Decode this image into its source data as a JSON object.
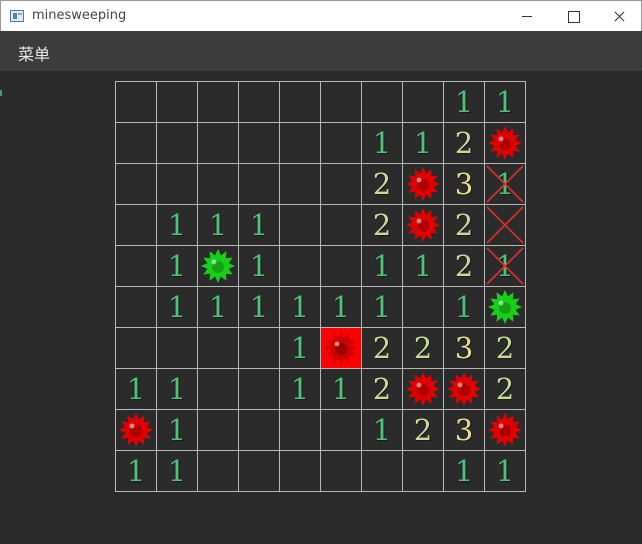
{
  "window": {
    "title": "minesweeping"
  },
  "menubar": {
    "menu_label": "菜单"
  },
  "colors": {
    "background": "#2b2b2b",
    "menubar": "#3c3c3c",
    "grid_line": "#b8b8b8",
    "num1": "#4fc27a",
    "num2": "#c8dc98",
    "num3": "#e8df8f",
    "mine_red": "#e00000",
    "mine_green": "#18d018",
    "hit_cell": "#ff0000",
    "wrong_flag_x": "#e03030"
  },
  "board": {
    "rows": 10,
    "cols": 10,
    "legend": "'' = blank, digit = number, 'M' = red mine, 'G' = green mine (flagged), 'H' = exploded mine cell, 'X' = wrong flag, 'X1' = wrong flag over 1",
    "cells": [
      [
        "",
        "",
        "",
        "",
        "",
        "",
        "",
        "",
        "1",
        "1"
      ],
      [
        "",
        "",
        "",
        "",
        "",
        "",
        "1",
        "1",
        "2",
        "M"
      ],
      [
        "",
        "",
        "",
        "",
        "",
        "",
        "2",
        "M",
        "3",
        "X1"
      ],
      [
        "",
        "1",
        "1",
        "1",
        "",
        "",
        "2",
        "M",
        "2",
        "X"
      ],
      [
        "",
        "1",
        "G",
        "1",
        "",
        "",
        "1",
        "1",
        "2",
        "X1"
      ],
      [
        "",
        "1",
        "1",
        "1",
        "1",
        "1",
        "1",
        "",
        "1",
        "G"
      ],
      [
        "",
        "",
        "",
        "",
        "1",
        "H",
        "2",
        "2",
        "3",
        "2"
      ],
      [
        "1",
        "1",
        "",
        "",
        "1",
        "1",
        "2",
        "M",
        "M",
        "2"
      ],
      [
        "M",
        "1",
        "",
        "",
        "",
        "",
        "1",
        "2",
        "3",
        "M"
      ],
      [
        "1",
        "1",
        "",
        "",
        "",
        "",
        "",
        "",
        "1",
        "1"
      ]
    ]
  }
}
